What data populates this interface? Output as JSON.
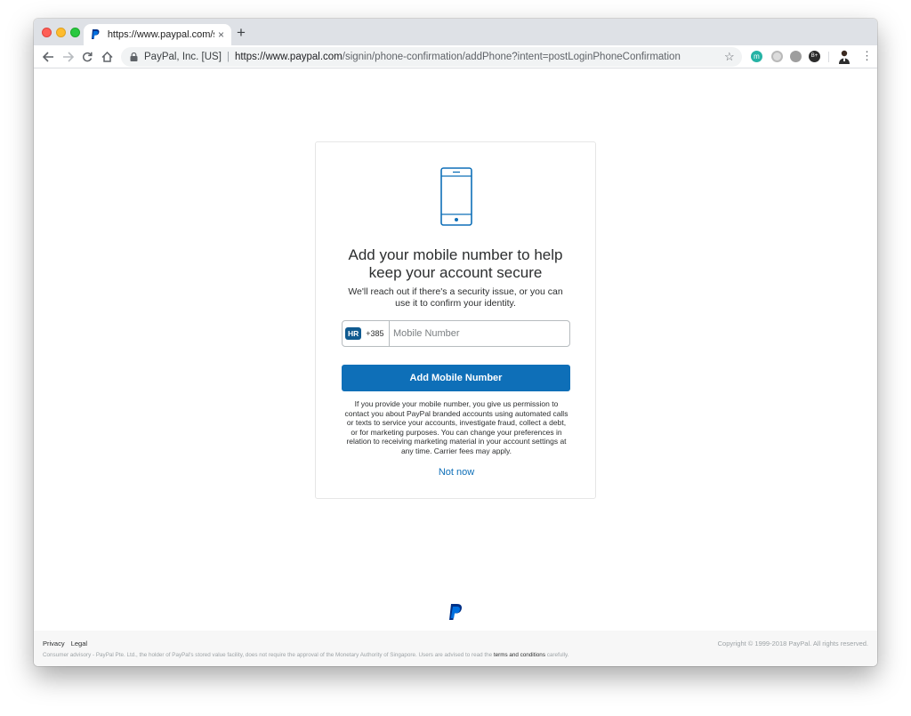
{
  "browser": {
    "tab_title": "https://www.paypal.com/signin",
    "tab_close": "×",
    "new_tab": "+",
    "site_identity": "PayPal, Inc. [US]",
    "url_host": "https://www.paypal.com",
    "url_path": "/signin/phone-confirmation/addPhone?intent=postLoginPhoneConfirmation",
    "extensions": [
      "m",
      "",
      "",
      "B+"
    ],
    "star": "☆",
    "menu": "⋮",
    "icons": [
      "back-arrow-icon",
      "forward-arrow-icon",
      "reload-icon",
      "home-icon",
      "lock-icon",
      "star-icon",
      "kebab-menu-icon"
    ]
  },
  "card": {
    "heading": "Add your mobile number to help keep your account secure",
    "subtext": "We'll reach out if there's a security issue, or you can use it to confirm your identity.",
    "country_code": "HR",
    "dial_code": "+385",
    "mobile_placeholder": "Mobile Number",
    "mobile_value": "",
    "primary_button": "Add Mobile Number",
    "disclaimer": "If you provide your mobile number, you give us permission to contact you about PayPal branded accounts using automated calls or texts to service your accounts, investigate fraud, collect a debt, or for marketing purposes. You can change your preferences in relation to receiving marketing material in your account settings at any time. Carrier fees may apply.",
    "not_now": "Not now"
  },
  "footer": {
    "privacy": "Privacy",
    "legal": "Legal",
    "copyright": "Copyright © 1999-2018 PayPal. All rights reserved.",
    "advisory_prefix": "Consumer advisory - PayPal Pte. Ltd., the holder of PayPal's stored value facility, does not require the approval of the Monetary Authority of Singapore. Users are advised to read the ",
    "advisory_link": "terms and conditions",
    "advisory_suffix": " carefully."
  },
  "colors": {
    "primary": "#0e6fb8",
    "text": "#2c2e2f",
    "muted": "#9da3a6"
  }
}
